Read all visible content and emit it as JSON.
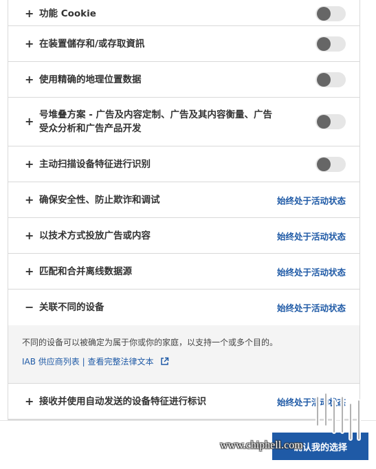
{
  "purposes": [
    {
      "label": "功能 Cookie",
      "control": "toggle",
      "expander": "+"
    },
    {
      "label": "在装置儲存和/或存取資訊",
      "control": "toggle",
      "expander": "+"
    },
    {
      "label": "使用精确的地理位置数据",
      "control": "toggle",
      "expander": "+"
    },
    {
      "label": "号堆叠方案 - 广告及内容定制、广告及其内容衡量、广告受众分析和广告产品开发",
      "control": "toggle",
      "expander": "+"
    },
    {
      "label": "主动扫描设备特征进行识别",
      "control": "toggle",
      "expander": "+"
    },
    {
      "label": "确保安全性、防止欺诈和调试",
      "control": "always",
      "status": "始终处于活动状态",
      "expander": "+"
    },
    {
      "label": "以技术方式投放广告或内容",
      "control": "always",
      "status": "始终处于活动状态",
      "expander": "+"
    },
    {
      "label": "匹配和合并离线数据源",
      "control": "always",
      "status": "始终处于活动状态",
      "expander": "+"
    },
    {
      "label": "关联不同的设备",
      "control": "always",
      "status": "始终处于活动状态",
      "expander": "−"
    },
    {
      "label": "接收并使用自动发送的设备特征进行标识",
      "control": "always",
      "status": "始终处于活动状态",
      "expander": "+"
    }
  ],
  "detail": {
    "text": "不同的设备可以被确定为属于你或你的家庭，以支持一个或多个目的。",
    "vendor_link": "IAB 供应商列表",
    "separator": "|",
    "legal_link": "查看完整法律文本"
  },
  "footer": {
    "confirm_label": "确认我的选择",
    "watermark": "www.chiphell.com"
  },
  "colors": {
    "accent": "#1f5aa6",
    "toggle_track": "#e6e6e6",
    "toggle_knob": "#666666",
    "detail_bg": "#f4f4f4"
  }
}
